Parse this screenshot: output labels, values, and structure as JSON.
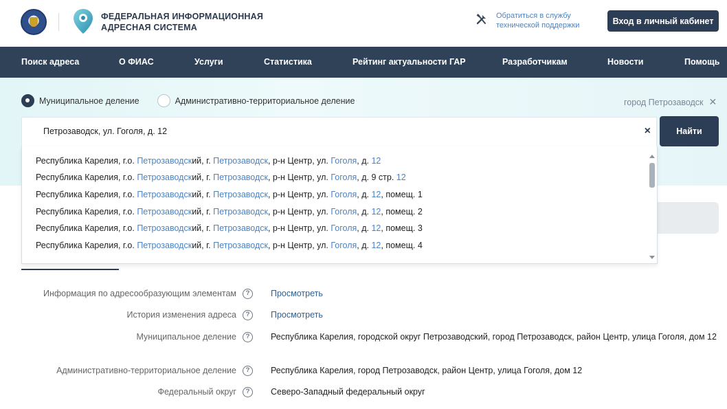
{
  "header": {
    "brand_line1": "ФЕДЕРАЛЬНАЯ ИНФОРМАЦИОННАЯ",
    "brand_line2": "АДРЕСНАЯ СИСТЕМА",
    "support_line1": "Обратиться в службу",
    "support_line2": "технической поддержки",
    "login_label": "Вход в личный кабинет"
  },
  "nav": {
    "items": [
      {
        "label": "Поиск адреса"
      },
      {
        "label": "О ФИАС"
      },
      {
        "label": "Услуги"
      },
      {
        "label": "Статистика"
      },
      {
        "label": "Рейтинг актуальности ГАР"
      },
      {
        "label": "Разработчикам"
      },
      {
        "label": "Новости"
      },
      {
        "label": "Помощь"
      }
    ]
  },
  "search": {
    "radio_municipal": "Муниципальное деление",
    "radio_admin": "Административно-территориальное деление",
    "selected": "municipal",
    "filter_tag": "город Петрозаводск",
    "value": "Петрозаводск, ул. Гоголя, д. 12",
    "button_label": "Найти",
    "suggestions": [
      [
        {
          "t": "Республика Карелия, г.о. "
        },
        {
          "t": "Петрозаводск",
          "h": true
        },
        {
          "t": "ий, г. "
        },
        {
          "t": "Петрозаводск",
          "h": true
        },
        {
          "t": ", р-н Центр, ул. "
        },
        {
          "t": "Гоголя",
          "h": true
        },
        {
          "t": ", д. "
        },
        {
          "t": "12",
          "h": true
        }
      ],
      [
        {
          "t": "Республика Карелия, г.о. "
        },
        {
          "t": "Петрозаводск",
          "h": true
        },
        {
          "t": "ий, г. "
        },
        {
          "t": "Петрозаводск",
          "h": true
        },
        {
          "t": ", р-н Центр, ул. "
        },
        {
          "t": "Гоголя",
          "h": true
        },
        {
          "t": ", д. 9 стр. "
        },
        {
          "t": "12",
          "h": true
        }
      ],
      [
        {
          "t": "Республика Карелия, г.о. "
        },
        {
          "t": "Петрозаводск",
          "h": true
        },
        {
          "t": "ий, г. "
        },
        {
          "t": "Петрозаводск",
          "h": true
        },
        {
          "t": ", р-н Центр, ул. "
        },
        {
          "t": "Гоголя",
          "h": true
        },
        {
          "t": ", д. "
        },
        {
          "t": "12",
          "h": true
        },
        {
          "t": ", помещ. 1"
        }
      ],
      [
        {
          "t": "Республика Карелия, г.о. "
        },
        {
          "t": "Петрозаводск",
          "h": true
        },
        {
          "t": "ий, г. "
        },
        {
          "t": "Петрозаводск",
          "h": true
        },
        {
          "t": ", р-н Центр, ул. "
        },
        {
          "t": "Гоголя",
          "h": true
        },
        {
          "t": ", д. "
        },
        {
          "t": "12",
          "h": true
        },
        {
          "t": ", помещ. 2"
        }
      ],
      [
        {
          "t": "Республика Карелия, г.о. "
        },
        {
          "t": "Петрозаводск",
          "h": true
        },
        {
          "t": "ий, г. "
        },
        {
          "t": "Петрозаводск",
          "h": true
        },
        {
          "t": ", р-н Центр, ул. "
        },
        {
          "t": "Гоголя",
          "h": true
        },
        {
          "t": ", д. "
        },
        {
          "t": "12",
          "h": true
        },
        {
          "t": ", помещ. 3"
        }
      ],
      [
        {
          "t": "Республика Карелия, г.о. "
        },
        {
          "t": "Петрозаводск",
          "h": true
        },
        {
          "t": "ий, г. "
        },
        {
          "t": "Петрозаводск",
          "h": true
        },
        {
          "t": ", р-н Центр, ул. "
        },
        {
          "t": "Гоголя",
          "h": true
        },
        {
          "t": ", д. "
        },
        {
          "t": "12",
          "h": true
        },
        {
          "t": ", помещ. 4"
        }
      ]
    ]
  },
  "details": {
    "info_label": "Информация по адресообразующим элементам",
    "info_link": "Просмотреть",
    "history_label": "История изменения адреса",
    "history_link": "Просмотреть",
    "municipal_label": "Муниципальное деление",
    "municipal_value": "Республика Карелия, городской округ Петрозаводский, город Петрозаводск, район Центр, улица Гоголя, дом 12",
    "admin_label": "Административно-территориальное деление",
    "admin_value": "Республика Карелия, город Петрозаводск, район Центр, улица Гоголя, дом 12",
    "fed_label": "Федеральный округ",
    "fed_value": "Северо-Западный федеральный округ",
    "help_glyph": "?"
  },
  "colors": {
    "nav_bg": "#2f4257",
    "accent_dark": "#2c3e55",
    "link_blue": "#4a83c4",
    "band_bg": "#e6f6f8"
  },
  "icons": [
    "emblem-icon",
    "location-pin-icon",
    "tools-icon",
    "close-icon",
    "help-icon"
  ]
}
